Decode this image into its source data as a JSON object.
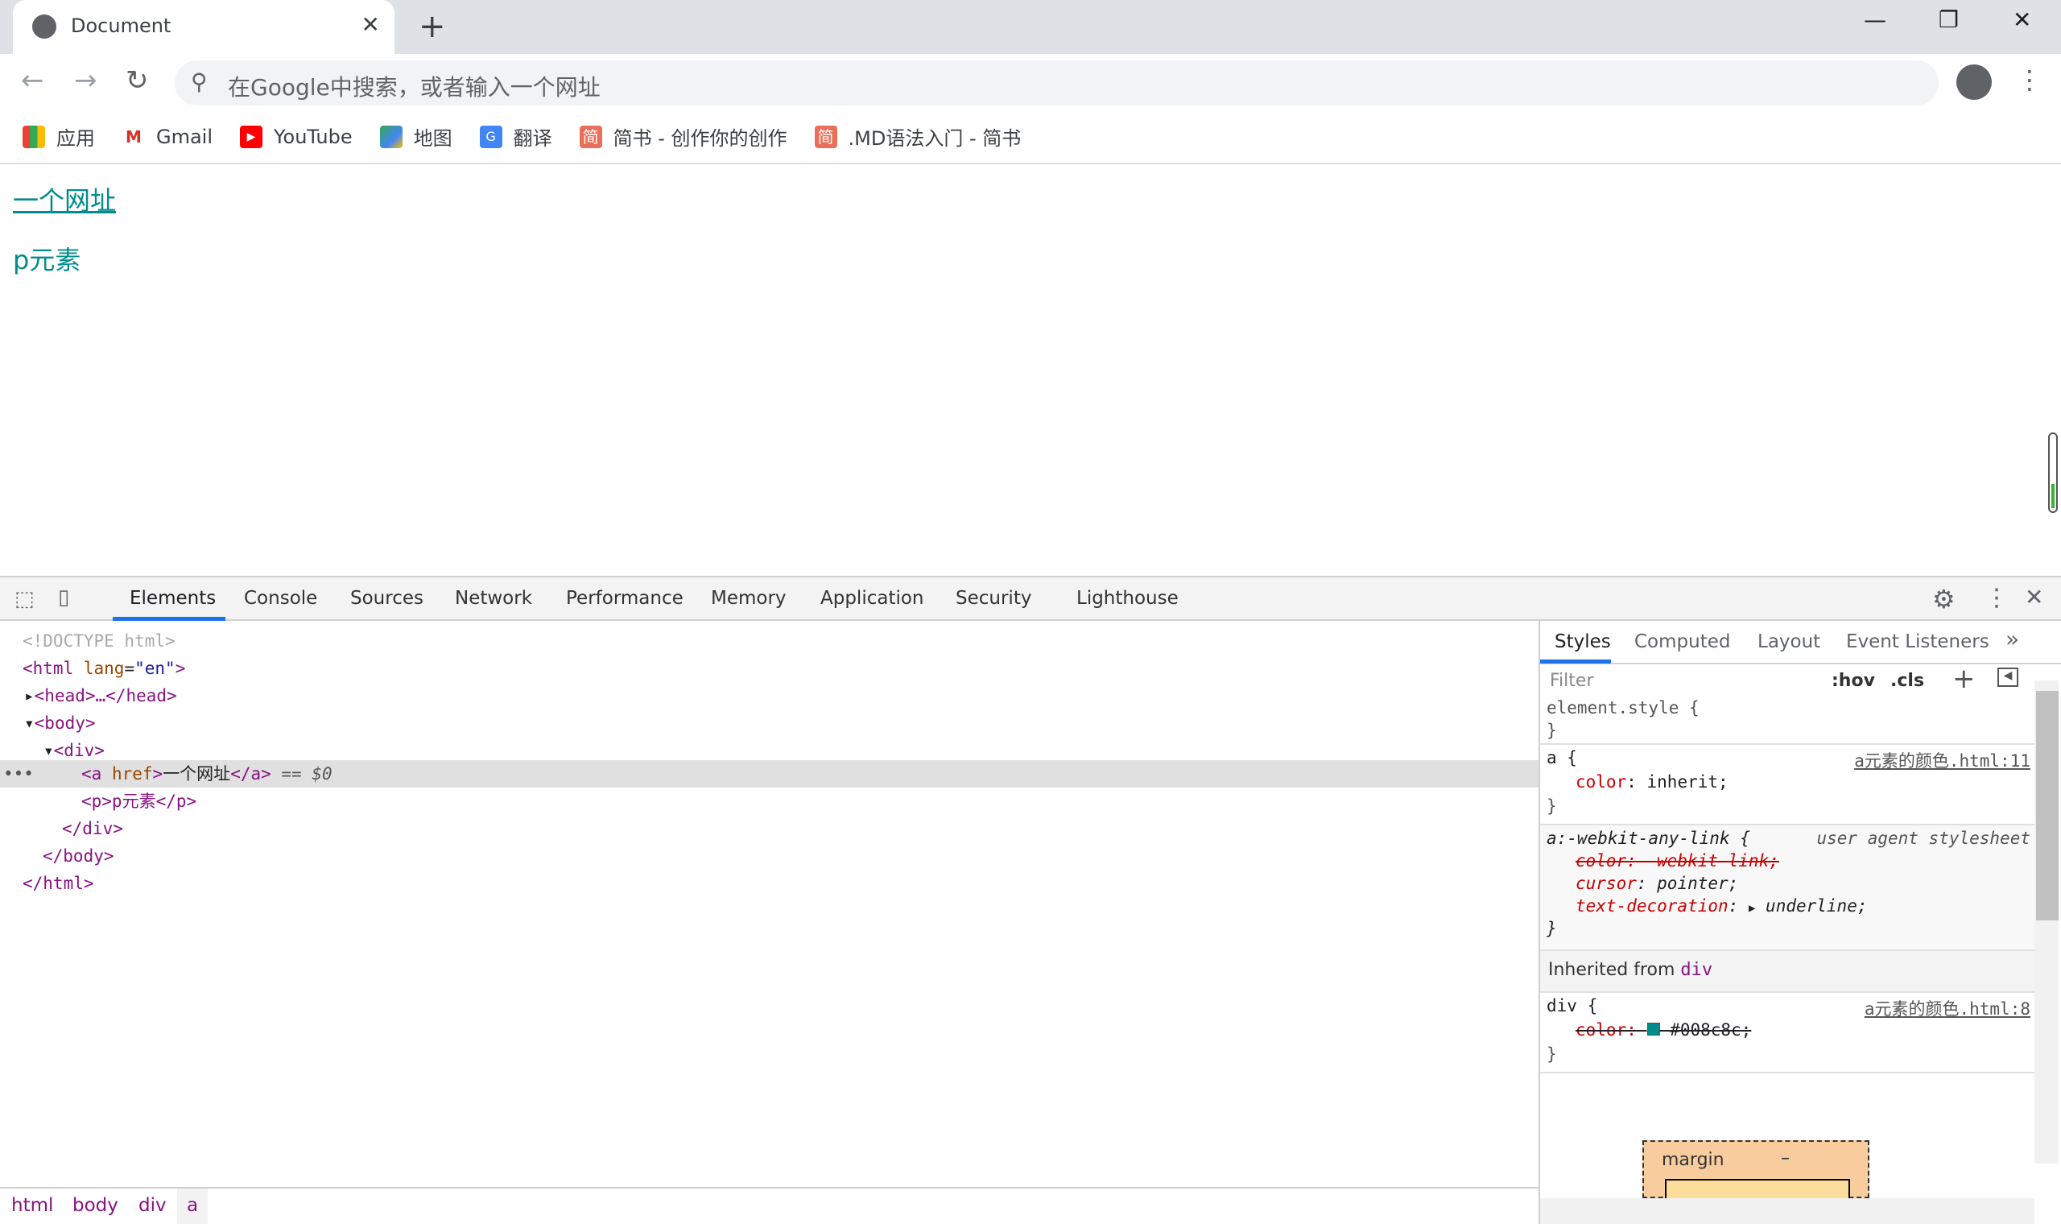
{
  "browser": {
    "tab_title": "Document",
    "omnibox_placeholder": "在Google中搜索，或者输入一个网址",
    "bookmarks": [
      {
        "label": "应用",
        "icon": "apps-grid-icon"
      },
      {
        "label": "Gmail",
        "icon": "gmail-icon"
      },
      {
        "label": "YouTube",
        "icon": "youtube-icon"
      },
      {
        "label": "地图",
        "icon": "maps-icon"
      },
      {
        "label": "翻译",
        "icon": "translate-icon"
      },
      {
        "label": "简书 - 创作你的创作",
        "icon": "jianshu-icon",
        "icon_text": "简"
      },
      {
        "label": ".MD语法入门 - 简书",
        "icon": "jianshu-icon",
        "icon_text": "简"
      }
    ]
  },
  "page": {
    "link_text": "一个网址",
    "p_text": "p元素",
    "text_color": "#008c8c"
  },
  "devtools": {
    "tabs": [
      "Elements",
      "Console",
      "Sources",
      "Network",
      "Performance",
      "Memory",
      "Application",
      "Security",
      "Lighthouse"
    ],
    "active_tab": "Elements",
    "dom": {
      "doctype": "<!DOCTYPE html>",
      "html_open": "<html",
      "lang_attr": "lang",
      "lang_val": "\"en\"",
      "head": "<head>…</head>",
      "body_open": "<body>",
      "div_open": "<div>",
      "a_open": "<a",
      "href": "href",
      "a_text": "一个网址",
      "a_close": "</a>",
      "selected_marker": "== $0",
      "p_line": "<p>p元素</p>",
      "div_close": "</div>",
      "body_close": "</body>",
      "html_close": "</html>",
      "dots": "•••"
    },
    "breadcrumbs": [
      "html",
      "body",
      "div",
      "a"
    ],
    "styles": {
      "tabs": [
        "Styles",
        "Computed",
        "Layout",
        "Event Listeners"
      ],
      "more": "»",
      "filter_placeholder": "Filter",
      "hov": ":hov",
      "cls": ".cls",
      "add": "+",
      "element_style": "element.style {",
      "close": "}",
      "rule_a": {
        "selector": "a {",
        "prop": "color",
        "value": "inherit;",
        "source": "a元素的颜色.html:11"
      },
      "rule_ua": {
        "selector": "a:-webkit-any-link {",
        "source": "user agent stylesheet",
        "p1": "color: -webkit-link;",
        "p2_prop": "cursor",
        "p2_val": "pointer;",
        "p3_prop": "text-decoration",
        "p3_val": "underline;"
      },
      "inherited_label": "Inherited from",
      "inherited_el": "div",
      "rule_div": {
        "selector": "div {",
        "prop": "color:",
        "value": "#008c8c;",
        "source": "a元素的颜色.html:8"
      },
      "box_margin": "margin",
      "box_margin_val": "–"
    }
  }
}
